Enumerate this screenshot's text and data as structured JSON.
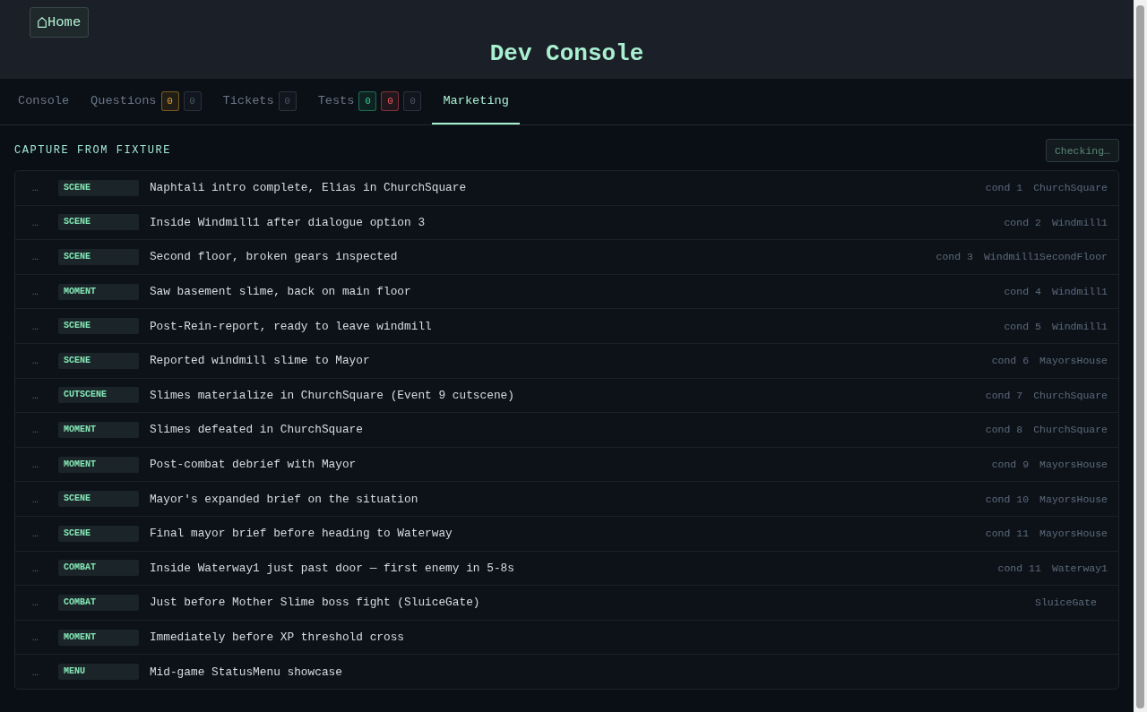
{
  "header": {
    "home_button": {
      "label": "Home"
    },
    "title": "Dev Console"
  },
  "tabs": [
    {
      "label": "Console",
      "selected": false
    },
    {
      "label": "Questions",
      "selected": false,
      "badges": [
        {
          "count": "0",
          "color": "#e9a82a"
        },
        {
          "count": "0",
          "color": "#4a5563"
        }
      ]
    },
    {
      "label": "Tickets",
      "selected": false,
      "badges": [
        {
          "count": "0",
          "color": "#4a5563"
        }
      ]
    },
    {
      "label": "Tests",
      "selected": false,
      "badges": [
        {
          "count": "0",
          "color": "#2fd08e"
        },
        {
          "count": "0",
          "color": "#ef5d5d"
        },
        {
          "count": "0",
          "color": "#4a5563"
        }
      ]
    },
    {
      "label": "Marketing",
      "selected": true
    }
  ],
  "capture": {
    "heading": "CAPTURE FROM FIXTURE",
    "check_button": {
      "label": "Checking…",
      "disabled": true
    },
    "fixtures": [
      {
        "status": "…",
        "tag": "SCENE",
        "description": "Naphtali intro complete, Elias in ChurchSquare",
        "cond": "cond 1",
        "location": "ChurchSquare"
      },
      {
        "status": "…",
        "tag": "SCENE",
        "description": "Inside Windmill1 after dialogue option 3",
        "cond": "cond 2",
        "location": "Windmill1"
      },
      {
        "status": "…",
        "tag": "SCENE",
        "description": "Second floor, broken gears inspected",
        "cond": "cond 3",
        "location": "Windmill1SecondFloor"
      },
      {
        "status": "…",
        "tag": "MOMENT",
        "description": "Saw basement slime, back on main floor",
        "cond": "cond 4",
        "location": "Windmill1"
      },
      {
        "status": "…",
        "tag": "SCENE",
        "description": "Post-Rein-report, ready to leave windmill",
        "cond": "cond 5",
        "location": "Windmill1"
      },
      {
        "status": "…",
        "tag": "SCENE",
        "description": "Reported windmill slime to Mayor",
        "cond": "cond 6",
        "location": "MayorsHouse"
      },
      {
        "status": "…",
        "tag": "CUTSCENE",
        "description": "Slimes materialize in ChurchSquare (Event 9 cutscene)",
        "cond": "cond 7",
        "location": "ChurchSquare"
      },
      {
        "status": "…",
        "tag": "MOMENT",
        "description": "Slimes defeated in ChurchSquare",
        "cond": "cond 8",
        "location": "ChurchSquare"
      },
      {
        "status": "…",
        "tag": "MOMENT",
        "description": "Post-combat debrief with Mayor",
        "cond": "cond 9",
        "location": "MayorsHouse"
      },
      {
        "status": "…",
        "tag": "SCENE",
        "description": "Mayor's expanded brief on the situation",
        "cond": "cond 10",
        "location": "MayorsHouse"
      },
      {
        "status": "…",
        "tag": "SCENE",
        "description": "Final mayor brief before heading to Waterway",
        "cond": "cond 11",
        "location": "MayorsHouse"
      },
      {
        "status": "…",
        "tag": "COMBAT",
        "description": "Inside Waterway1 just past door — first enemy in 5-8s",
        "cond": "cond 11",
        "location": "Waterway1"
      },
      {
        "status": "…",
        "tag": "COMBAT",
        "description": "Just before Mother Slime boss fight (SluiceGate)",
        "location": "SluiceGate"
      },
      {
        "status": "…",
        "tag": "MOMENT",
        "description": "Immediately before XP threshold cross"
      },
      {
        "status": "…",
        "tag": "MENU",
        "description": "Mid-game StatusMenu showcase"
      }
    ]
  }
}
